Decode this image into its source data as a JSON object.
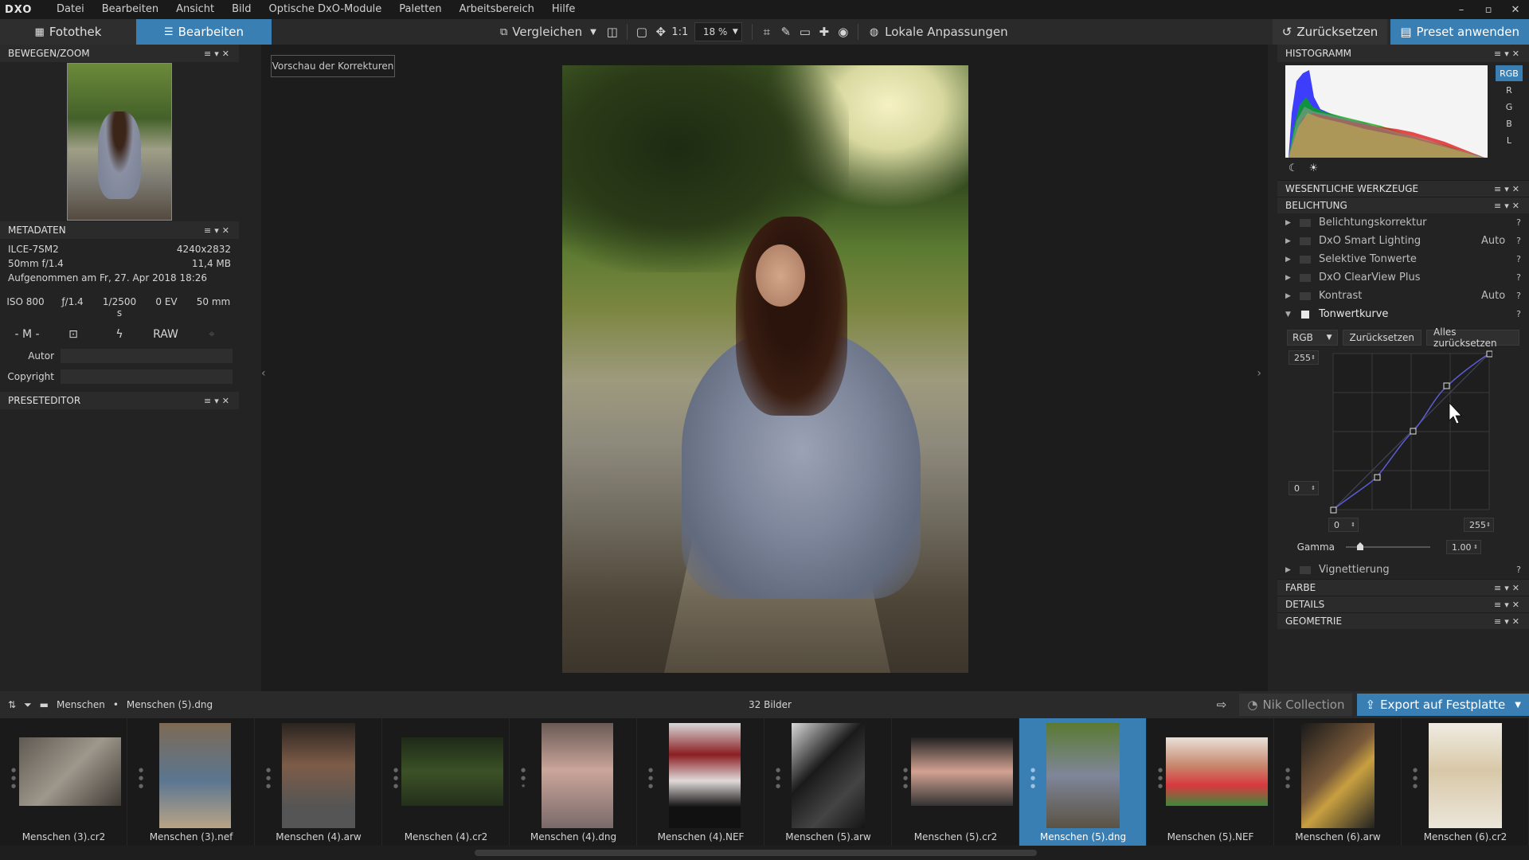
{
  "app": {
    "logo": "DXO"
  },
  "menu": [
    "Datei",
    "Bearbeiten",
    "Ansicht",
    "Bild",
    "Optische DxO-Module",
    "Paletten",
    "Arbeitsbereich",
    "Hilfe"
  ],
  "window_controls": [
    "–",
    "▫",
    "✕"
  ],
  "toolbar": {
    "tab_library": "Fotothek",
    "tab_edit": "Bearbeiten",
    "compare": "Vergleichen",
    "one_to_one": "1:1",
    "zoom": "18 %",
    "local_adjust": "Lokale Anpassungen",
    "reset": "Zurücksetzen",
    "apply_preset": "Preset anwenden"
  },
  "left": {
    "move_zoom_title": "BEWEGEN/ZOOM",
    "metadata_title": "METADATEN",
    "camera": "ILCE-7SM2",
    "resolution": "4240x2832",
    "lens": "50mm f/1.4",
    "size": "11,4 MB",
    "taken": "Aufgenommen am Fr, 27. Apr 2018 18:26",
    "iso": "ISO 800",
    "aperture": "ƒ/1.4",
    "shutter": "1/2500 s",
    "ev": "0 EV",
    "focal": "50 mm",
    "mode": "- M -",
    "raw": "RAW",
    "author_label": "Autor",
    "copyright_label": "Copyright",
    "preset_title": "PRESETEDITOR"
  },
  "viewer": {
    "preview_button": "Vorschau der Korrekturen"
  },
  "right": {
    "histogram_title": "HISTOGRAMM",
    "histo_channels": [
      "RGB",
      "R",
      "G",
      "B",
      "L"
    ],
    "essential_tools": "WESENTLICHE WERKZEUGE",
    "exposure_section": "BELICHTUNG",
    "tools": [
      {
        "name": "Belichtungskorrektur",
        "value": ""
      },
      {
        "name": "DxO Smart Lighting",
        "value": "Auto"
      },
      {
        "name": "Selektive Tonwerte",
        "value": ""
      },
      {
        "name": "DxO ClearView Plus",
        "value": ""
      },
      {
        "name": "Kontrast",
        "value": "Auto"
      }
    ],
    "tone_curve": "Tonwertkurve",
    "channel": "RGB",
    "curve_reset": "Zurücksetzen",
    "curve_reset_all": "Alles zurücksetzen",
    "out_max": "255",
    "out_min": "0",
    "in_min": "0",
    "in_max": "255",
    "gamma_label": "Gamma",
    "gamma_value": "1.00",
    "vignetting": "Vignettierung",
    "help": "?",
    "section_color": "FARBE",
    "section_details": "DETAILS",
    "section_geometry": "GEOMETRIE"
  },
  "filmbar": {
    "folder": "Menschen",
    "file": "Menschen (5).dng",
    "count": "32 Bilder",
    "nik": "Nik Collection",
    "export": "Export auf Festplatte"
  },
  "film_items": [
    "Menschen (3).cr2",
    "Menschen (3).nef",
    "Menschen (4).arw",
    "Menschen (4).cr2",
    "Menschen (4).dng",
    "Menschen (4).NEF",
    "Menschen (5).arw",
    "Menschen (5).cr2",
    "Menschen (5).dng",
    "Menschen (5).NEF",
    "Menschen (6).arw",
    "Menschen (6).cr2"
  ],
  "colors": {
    "accent": "#3a7fb4",
    "panel": "#232323",
    "viewer": "#1c1c1c"
  }
}
